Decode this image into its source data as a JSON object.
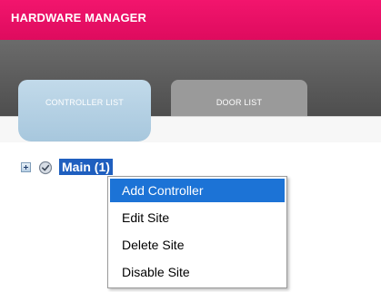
{
  "app": {
    "title": "HARDWARE MANAGER"
  },
  "tabs": [
    {
      "label": "CONTROLLER LIST",
      "active": true
    },
    {
      "label": "DOOR LIST",
      "active": false
    }
  ],
  "tree": {
    "node_label": "Main (1)",
    "expand_icon": "plus-expand-icon",
    "node_icon": "site-status-icon"
  },
  "context_menu": {
    "items": [
      {
        "label": "Add Controller",
        "selected": true
      },
      {
        "label": "Edit Site",
        "selected": false
      },
      {
        "label": "Delete Site",
        "selected": false
      },
      {
        "label": "Disable Site",
        "selected": false
      }
    ]
  },
  "colors": {
    "header": "#e8106a",
    "nav_band": "#5c5c5c",
    "active_tab": "#b4d0e4",
    "inactive_tab": "#9a9a9a",
    "selection": "#1c73d6"
  }
}
